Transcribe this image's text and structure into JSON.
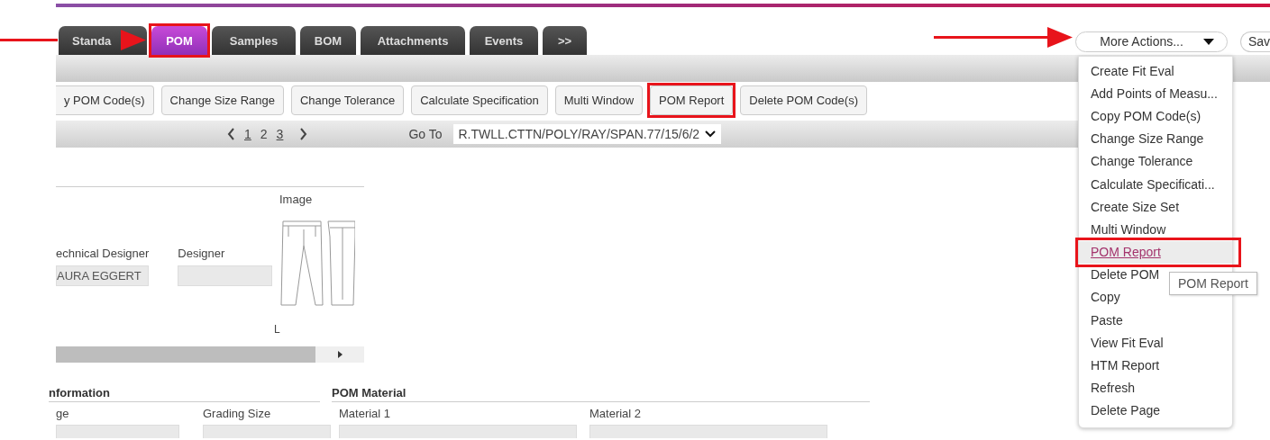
{
  "tabs": [
    {
      "label": "Standa",
      "selected": false
    },
    {
      "label": "POM",
      "selected": true
    },
    {
      "label": "Samples",
      "selected": false
    },
    {
      "label": "BOM",
      "selected": false
    },
    {
      "label": "Attachments",
      "selected": false
    },
    {
      "label": "Events",
      "selected": false
    },
    {
      "label": ">>",
      "selected": false
    }
  ],
  "header_actions": {
    "more_actions": "More Actions...",
    "save": "Sav"
  },
  "toolbar": [
    "y POM Code(s)",
    "Change Size Range",
    "Change Tolerance",
    "Calculate Specification",
    "Multi Window",
    "POM Report",
    "Delete POM Code(s)"
  ],
  "pager": {
    "pages": [
      {
        "label": "1",
        "selected": false
      },
      {
        "label": "2",
        "selected": true
      },
      {
        "label": "3",
        "selected": false
      }
    ],
    "goto_label": "Go To",
    "goto_value": "R.TWLL.CTTN/POLY/RAY/SPAN.77/15/6/2"
  },
  "details": {
    "fields": [
      {
        "label": "echnical Designer",
        "value": "AURA EGGERT"
      },
      {
        "label": "Designer"
      }
    ],
    "image_label": "Image",
    "image_caption": "L"
  },
  "sections": [
    {
      "title": "nformation",
      "fields": [
        "ge",
        "Grading Size"
      ]
    },
    {
      "title": "POM Material",
      "fields": [
        "Material 1",
        "Material 2"
      ]
    }
  ],
  "menu": {
    "items": [
      {
        "label": "Create Fit Eval",
        "selected": false
      },
      {
        "label": "Add Points of Measu...",
        "selected": false
      },
      {
        "label": "Copy POM Code(s)",
        "selected": false
      },
      {
        "label": "Change Size Range",
        "selected": false
      },
      {
        "label": "Change Tolerance",
        "selected": false
      },
      {
        "label": "Calculate Specificati...",
        "selected": false
      },
      {
        "label": "Create Size Set",
        "selected": false
      },
      {
        "label": "Multi Window",
        "selected": false
      },
      {
        "label": "POM Report",
        "selected": true
      },
      {
        "label": "Delete POM",
        "selected": false
      },
      {
        "label": "Copy",
        "selected": false
      },
      {
        "label": "Paste",
        "selected": false
      },
      {
        "label": "View Fit Eval",
        "selected": false
      },
      {
        "label": "HTM Report",
        "selected": false
      },
      {
        "label": "Refresh",
        "selected": false
      },
      {
        "label": "Delete Page",
        "selected": false
      }
    ]
  },
  "tooltip": "POM Report"
}
